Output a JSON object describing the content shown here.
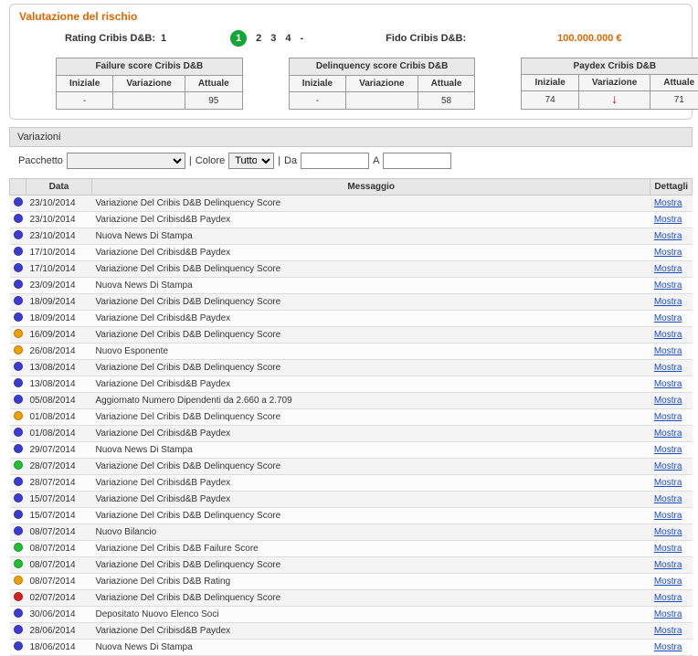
{
  "sectionTitle": "Valutazione del rischio",
  "ratingLabel": "Rating Cribis D&B:",
  "ratingValue": "1",
  "pages": [
    "1",
    "2",
    "3",
    "4",
    "-"
  ],
  "fidoLabel": "Fido Cribis D&B:",
  "fidoValue": "100.000.000 €",
  "scoreTables": [
    {
      "title": "Failure score Cribis D&B",
      "cols": [
        "Iniziale",
        "Variazione",
        "Attuale"
      ],
      "vals": [
        "-",
        "",
        "95"
      ]
    },
    {
      "title": "Delinquency score Cribis D&B",
      "cols": [
        "Iniziale",
        "Variazione",
        "Attuale"
      ],
      "vals": [
        "-",
        "",
        "58"
      ]
    },
    {
      "title": "Paydex Cribis D&B",
      "cols": [
        "Iniziale",
        "Variazione",
        "Attuale"
      ],
      "vals": [
        "74",
        "↓",
        "71"
      ],
      "arrow": true
    }
  ],
  "variazioniHeader": "Variazioni",
  "filters": {
    "pacchettoLabel": "Pacchetto",
    "sep": "|",
    "coloreLabel": "Colore",
    "coloreValue": "Tutto",
    "daLabel": "Da",
    "aLabel": "A"
  },
  "tableHeaders": {
    "dot": "",
    "data": "Data",
    "msg": "Messaggio",
    "det": "Dettagli"
  },
  "detailsLabel": "Mostra",
  "rows": [
    {
      "c": "blue",
      "d": "23/10/2014",
      "m": "Variazione Del Cribis D&B Delinquency Score"
    },
    {
      "c": "blue",
      "d": "23/10/2014",
      "m": "Variazione Del Cribisd&B Paydex"
    },
    {
      "c": "blue",
      "d": "23/10/2014",
      "m": "Nuova News Di Stampa"
    },
    {
      "c": "blue",
      "d": "17/10/2014",
      "m": "Variazione Del Cribisd&B Paydex"
    },
    {
      "c": "blue",
      "d": "17/10/2014",
      "m": "Variazione Del Cribis D&B Delinquency Score"
    },
    {
      "c": "blue",
      "d": "23/09/2014",
      "m": "Nuova News Di Stampa"
    },
    {
      "c": "blue",
      "d": "18/09/2014",
      "m": "Variazione Del Cribis D&B Delinquency Score"
    },
    {
      "c": "blue",
      "d": "18/09/2014",
      "m": "Variazione Del Cribisd&B Paydex"
    },
    {
      "c": "orange",
      "d": "16/09/2014",
      "m": "Variazione Del Cribis D&B Delinquency Score"
    },
    {
      "c": "orange",
      "d": "26/08/2014",
      "m": "Nuovo Esponente"
    },
    {
      "c": "blue",
      "d": "13/08/2014",
      "m": "Variazione Del Cribis D&B Delinquency Score"
    },
    {
      "c": "blue",
      "d": "13/08/2014",
      "m": "Variazione Del Cribisd&B Paydex"
    },
    {
      "c": "blue",
      "d": "05/08/2014",
      "m": "Aggiornato Numero Dipendenti da 2.660 a 2.709"
    },
    {
      "c": "orange",
      "d": "01/08/2014",
      "m": "Variazione Del Cribis D&B Delinquency Score"
    },
    {
      "c": "blue",
      "d": "01/08/2014",
      "m": "Variazione Del Cribisd&B Paydex"
    },
    {
      "c": "blue",
      "d": "29/07/2014",
      "m": "Nuova News Di Stampa"
    },
    {
      "c": "green",
      "d": "28/07/2014",
      "m": "Variazione Del Cribis D&B Delinquency Score"
    },
    {
      "c": "blue",
      "d": "28/07/2014",
      "m": "Variazione Del Cribisd&B Paydex"
    },
    {
      "c": "blue",
      "d": "15/07/2014",
      "m": "Variazione Del Cribisd&B Paydex"
    },
    {
      "c": "blue",
      "d": "15/07/2014",
      "m": "Variazione Del Cribis D&B Delinquency Score"
    },
    {
      "c": "blue",
      "d": "08/07/2014",
      "m": "Nuovo Bilancio"
    },
    {
      "c": "green",
      "d": "08/07/2014",
      "m": "Variazione Del Cribis D&B Failure Score"
    },
    {
      "c": "green",
      "d": "08/07/2014",
      "m": "Variazione Del Cribis D&B Delinquency Score"
    },
    {
      "c": "orange",
      "d": "08/07/2014",
      "m": "Variazione Del Cribis D&B Rating"
    },
    {
      "c": "red",
      "d": "02/07/2014",
      "m": "Variazione Del Cribis D&B Delinquency Score"
    },
    {
      "c": "blue",
      "d": "30/06/2014",
      "m": "Depositato Nuovo Elenco Soci"
    },
    {
      "c": "blue",
      "d": "28/06/2014",
      "m": "Variazione Del Cribisd&B Paydex"
    },
    {
      "c": "blue",
      "d": "18/06/2014",
      "m": "Nuova News Di Stampa"
    }
  ]
}
